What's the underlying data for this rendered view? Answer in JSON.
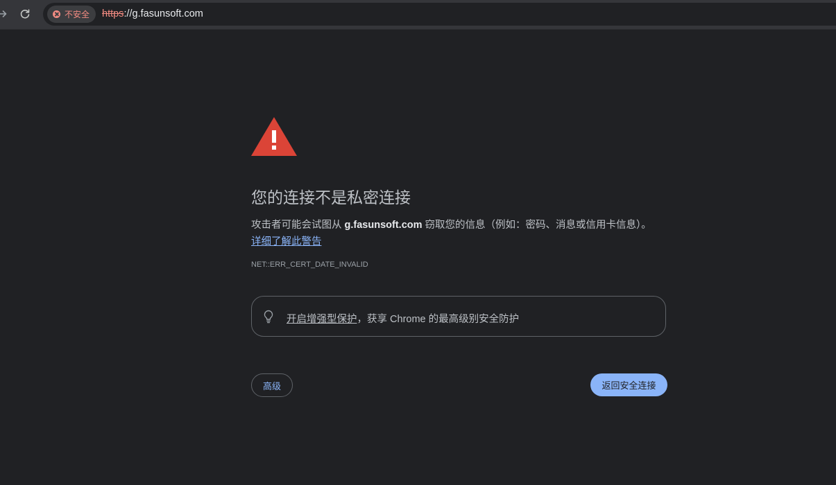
{
  "toolbar": {
    "security_chip_label": "不安全",
    "url_scheme": "https",
    "url_rest": "://g.fasunsoft.com"
  },
  "interstitial": {
    "heading": "您的连接不是私密连接",
    "description_prefix": "攻击者可能会试图从 ",
    "host": "g.fasunsoft.com",
    "description_suffix": " 窃取您的信息（例如：密码、消息或信用卡信息）。",
    "learn_more_link": "详细了解此警告",
    "error_code": "NET::ERR_CERT_DATE_INVALID",
    "promo_link": "开启增强型保护",
    "promo_suffix": "，获享 Chrome 的最高级别安全防护",
    "advanced_button": "高级",
    "back_button": "返回安全连接"
  },
  "colors": {
    "background": "#202124",
    "warning_red": "#db4437",
    "link_blue": "#8ab4f8",
    "not_secure_red": "#f28b82"
  },
  "icons": {
    "forward": "arrow-right-icon",
    "reload": "reload-icon",
    "not_secure": "not-secure-icon",
    "warning": "warning-triangle-icon",
    "promo": "lightbulb-icon"
  }
}
